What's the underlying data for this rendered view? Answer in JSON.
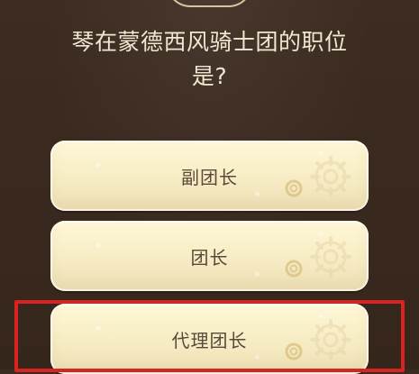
{
  "question": {
    "line1": "琴在蒙德西风骑士团的职位",
    "line2": "是?"
  },
  "options": [
    {
      "label": "副团长"
    },
    {
      "label": "团长"
    },
    {
      "label": "代理团长"
    }
  ],
  "colors": {
    "background": "#3b2a1f",
    "question_text": "#f2e7d1",
    "option_bg": "#f8eec7",
    "option_text": "#5b4a3a",
    "highlight": "#d9231f"
  },
  "icons": {
    "top_ornament": "decorative-arc",
    "option_decoration": "gear-icon"
  }
}
